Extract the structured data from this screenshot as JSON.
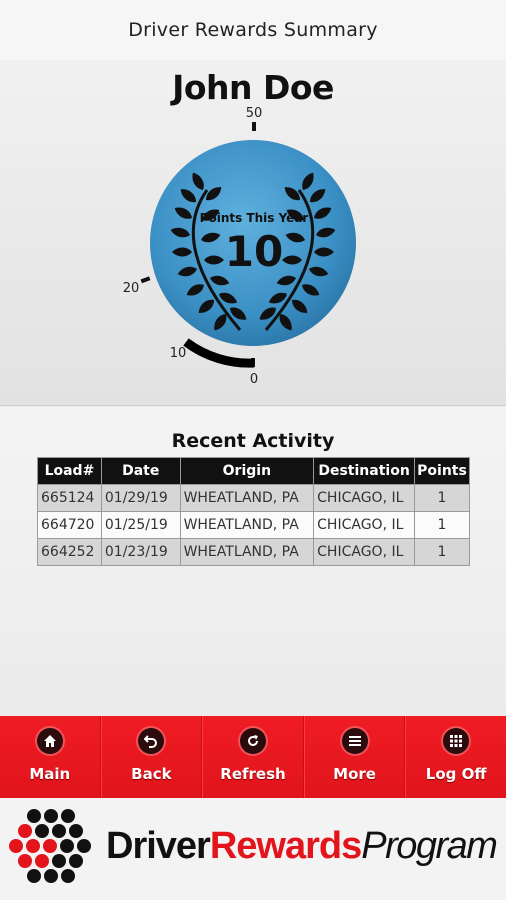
{
  "header": {
    "title": "Driver Rewards Summary"
  },
  "driver": {
    "name": "John Doe"
  },
  "gauge": {
    "points_label": "Points This Year",
    "points_value": "10",
    "ticks": [
      "50",
      "20",
      "10",
      "0"
    ],
    "max": 50,
    "current": 10,
    "colors": {
      "medallion": "#3b93c8",
      "laurel": "#111111",
      "progress": "#000000"
    }
  },
  "activity": {
    "title": "Recent Activity",
    "columns": [
      "Load#",
      "Date",
      "Origin",
      "Destination",
      "Points"
    ],
    "rows": [
      {
        "load": "665124",
        "date": "01/29/19",
        "origin": "WHEATLAND, PA",
        "destination": "CHICAGO, IL",
        "points": "1"
      },
      {
        "load": "664720",
        "date": "01/25/19",
        "origin": "WHEATLAND, PA",
        "destination": "CHICAGO, IL",
        "points": "1"
      },
      {
        "load": "664252",
        "date": "01/23/19",
        "origin": "WHEATLAND, PA",
        "destination": "CHICAGO, IL",
        "points": "1"
      }
    ]
  },
  "nav": {
    "items": [
      {
        "label": "Main",
        "icon": "home-icon"
      },
      {
        "label": "Back",
        "icon": "back-icon"
      },
      {
        "label": "Refresh",
        "icon": "refresh-icon"
      },
      {
        "label": "More",
        "icon": "menu-icon"
      },
      {
        "label": "Log Off",
        "icon": "grid-icon"
      }
    ],
    "color": "#e8171e"
  },
  "footer": {
    "brand_driver": "Driver",
    "brand_rewards": "Rewards",
    "brand_program": "Program",
    "colors": {
      "accent": "#e3141b",
      "dark": "#111111"
    }
  }
}
